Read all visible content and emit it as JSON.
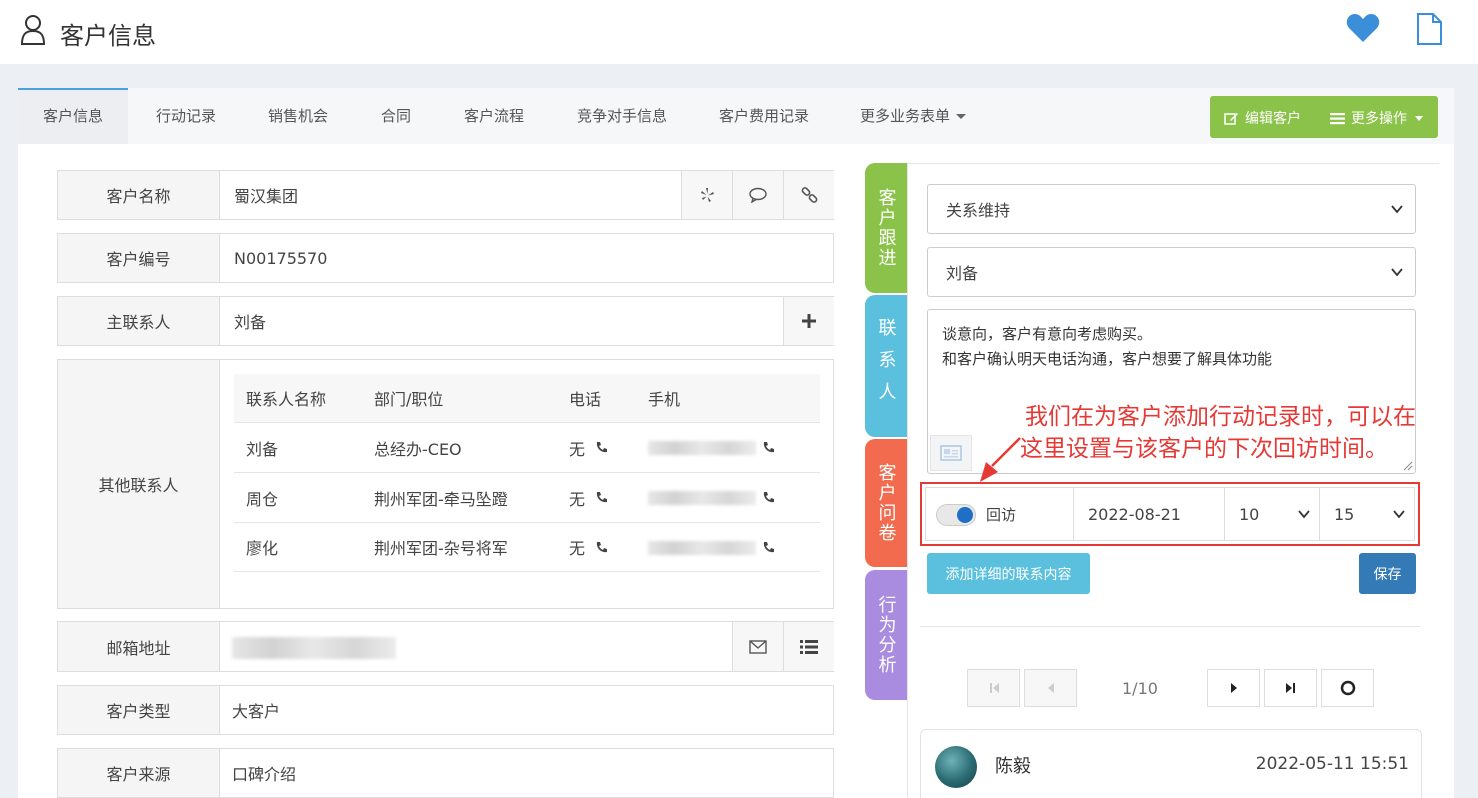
{
  "header": {
    "title": "客户信息",
    "icons": [
      "user-icon",
      "heart-icon",
      "document-icon"
    ],
    "heart_color": "#3b8fd9"
  },
  "tabs": [
    {
      "label": "客户信息",
      "active": true
    },
    {
      "label": "行动记录"
    },
    {
      "label": "销售机会"
    },
    {
      "label": "合同"
    },
    {
      "label": "客户流程"
    },
    {
      "label": "竞争对手信息"
    },
    {
      "label": "客户费用记录"
    },
    {
      "label": "更多业务表单"
    }
  ],
  "actions": {
    "edit_label": "编辑客户",
    "more_label": "更多操作",
    "color": "#8bc34a"
  },
  "form": {
    "customer_name": {
      "label": "客户名称",
      "value": "蜀汉集团"
    },
    "customer_no": {
      "label": "客户编号",
      "value": "N00175570"
    },
    "main_contact": {
      "label": "主联系人",
      "value": "刘备"
    },
    "other_contacts": {
      "label": "其他联系人",
      "headers": [
        "联系人名称",
        "部门/职位",
        "电话",
        "手机"
      ],
      "rows": [
        {
          "name": "刘备",
          "dept": "总经办-CEO",
          "phone": "无"
        },
        {
          "name": "周仓",
          "dept": "荆州军团-牵马坠蹬",
          "phone": "无"
        },
        {
          "name": "廖化",
          "dept": "荆州军团-杂号将军",
          "phone": "无"
        }
      ]
    },
    "email": {
      "label": "邮箱地址"
    },
    "customer_type": {
      "label": "客户类型",
      "value": "大客户"
    },
    "customer_source": {
      "label": "客户来源",
      "value": "口碑介绍"
    }
  },
  "side_tabs": [
    {
      "label": "客户跟进",
      "color": "#8bc34a"
    },
    {
      "label": "联系人",
      "color": "#5bc0de"
    },
    {
      "label": "客户问卷",
      "color": "#f26b4f"
    },
    {
      "label": "行为分析",
      "color": "#a98be0"
    }
  ],
  "followup": {
    "type_select": "关系维持",
    "contact_select": "刘备",
    "note_line1": "谈意向，客户有意向考虑购买。",
    "note_line2": "和客户确认明天电话沟通，客户想要了解具体功能",
    "annotation_line1": "我们在为客户添加行动记录时，可以在",
    "annotation_line2": "这里设置与该客户的下次回访时间。",
    "revisit_label": "回访",
    "revisit_on": true,
    "revisit_date": "2022-08-21",
    "revisit_hour": "10",
    "revisit_minute": "15",
    "add_detail_label": "添加详细的联系内容",
    "save_label": "保存"
  },
  "pagination": {
    "info": "1/10"
  },
  "record": {
    "name": "陈毅",
    "time": "2022-05-11 15:51"
  }
}
